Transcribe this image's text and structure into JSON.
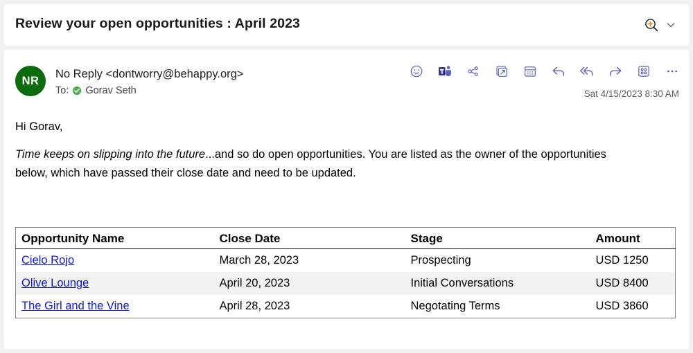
{
  "subject": {
    "title": "Review your open opportunities : April 2023",
    "zoom_icon": "zoom-in-icon",
    "chevron_icon": "chevron-down-icon"
  },
  "message": {
    "avatar_initials": "NR",
    "avatar_color": "#0b6a0b",
    "sender": "No Reply <dontworry@behappy.org>",
    "to_label": "To:",
    "recipient": "Gorav Seth",
    "verified_icon": "verified-check-icon",
    "verified_color": "#4caf50",
    "timestamp": "Sat 4/15/2023 8:30 AM",
    "toolbar": [
      {
        "name": "react-emoji-icon",
        "label": "React"
      },
      {
        "name": "microsoft-teams-icon",
        "label": "Share to Teams"
      },
      {
        "name": "share-icon",
        "label": "Share"
      },
      {
        "name": "pop-out-icon",
        "label": "Open in new window"
      },
      {
        "name": "calendar-icon",
        "label": "Schedule"
      },
      {
        "name": "reply-icon",
        "label": "Reply"
      },
      {
        "name": "reply-all-icon",
        "label": "Reply all"
      },
      {
        "name": "forward-icon",
        "label": "Forward"
      },
      {
        "name": "apps-grid-icon",
        "label": "Apps"
      },
      {
        "name": "more-options-icon",
        "label": "More actions"
      }
    ],
    "toolbar_color": "#5b5fc7"
  },
  "body": {
    "greeting": "Hi Gorav,",
    "intro_italic": "Time keeps on slipping into the future",
    "intro_rest": "...and so do open opportunities. You are listed as the owner of the opportunities below, which have passed their close date and need to be updated."
  },
  "table": {
    "headers": [
      "Opportunity Name",
      "Close Date",
      "Stage",
      "Amount"
    ],
    "rows": [
      {
        "name": "Cielo Rojo",
        "close_date": "March 28, 2023",
        "stage": "Prospecting",
        "amount": "USD 1250"
      },
      {
        "name": "Olive Lounge",
        "close_date": "April 20, 2023",
        "stage": "Initial Conversations",
        "amount": "USD 8400"
      },
      {
        "name": "The Girl and the Vine",
        "close_date": "April 28, 2023",
        "stage": "Negotating Terms",
        "amount": "USD 3860"
      }
    ],
    "link_color": "#0f17d6"
  }
}
